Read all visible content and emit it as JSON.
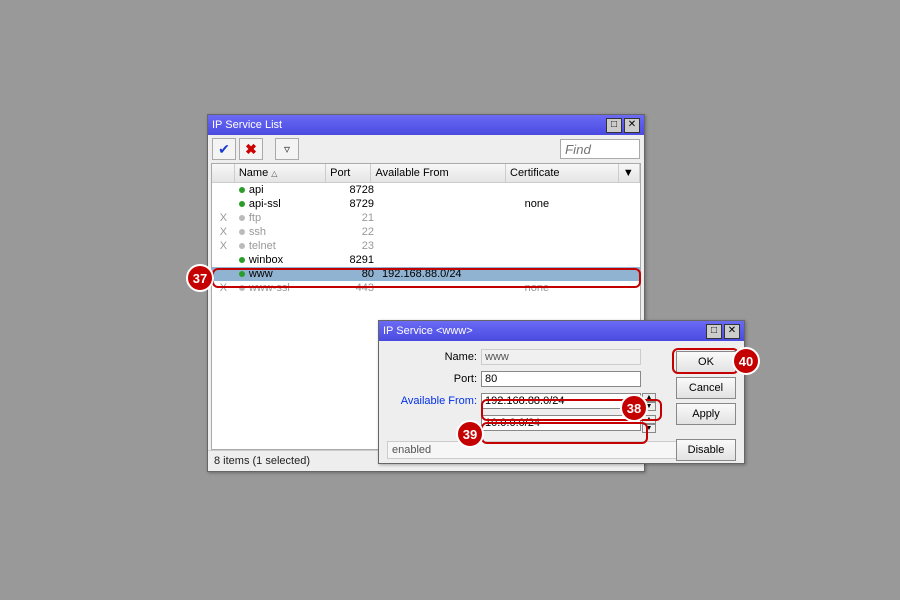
{
  "list_window": {
    "title": "IP Service List",
    "find_placeholder": "Find",
    "columns": {
      "name": "Name",
      "port": "Port",
      "avail": "Available From",
      "cert": "Certificate"
    },
    "rows": [
      {
        "x": "",
        "name": "api",
        "port": "8728",
        "avail": "",
        "cert": "",
        "enabled": true
      },
      {
        "x": "",
        "name": "api-ssl",
        "port": "8729",
        "avail": "",
        "cert": "none",
        "enabled": true
      },
      {
        "x": "X",
        "name": "ftp",
        "port": "21",
        "avail": "",
        "cert": "",
        "enabled": false
      },
      {
        "x": "X",
        "name": "ssh",
        "port": "22",
        "avail": "",
        "cert": "",
        "enabled": false
      },
      {
        "x": "X",
        "name": "telnet",
        "port": "23",
        "avail": "",
        "cert": "",
        "enabled": false
      },
      {
        "x": "",
        "name": "winbox",
        "port": "8291",
        "avail": "",
        "cert": "",
        "enabled": true
      },
      {
        "x": "",
        "name": "www",
        "port": "80",
        "avail": "192.168.88.0/24",
        "cert": "",
        "enabled": true,
        "selected": true
      },
      {
        "x": "X",
        "name": "www-ssl",
        "port": "443",
        "avail": "",
        "cert": "none",
        "enabled": false
      }
    ],
    "status": "8 items (1 selected)"
  },
  "detail_window": {
    "title": "IP Service <www>",
    "labels": {
      "name": "Name:",
      "port": "Port:",
      "avail": "Available From:"
    },
    "values": {
      "name": "www",
      "port": "80",
      "avail1": "192.168.88.0/24",
      "avail2": "10.0.0.0/24"
    },
    "buttons": {
      "ok": "OK",
      "cancel": "Cancel",
      "apply": "Apply",
      "disable": "Disable"
    },
    "state": "enabled"
  },
  "callouts": {
    "37": "37",
    "38": "38",
    "39": "39",
    "40": "40"
  }
}
